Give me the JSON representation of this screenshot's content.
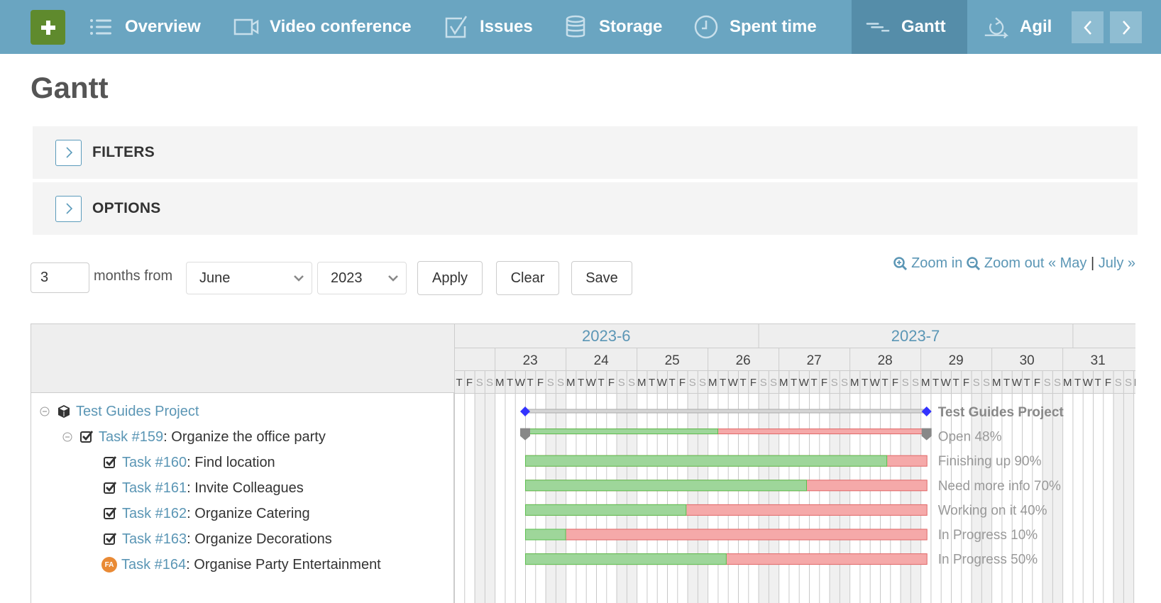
{
  "nav": {
    "add_label": "+",
    "items": [
      {
        "label": "Overview",
        "icon": "list-icon"
      },
      {
        "label": "Video conference",
        "icon": "video-camera-icon"
      },
      {
        "label": "Issues",
        "icon": "checkbox-icon"
      },
      {
        "label": "Storage",
        "icon": "database-icon"
      },
      {
        "label": "Spent time",
        "icon": "clock-icon"
      },
      {
        "label": "Gantt",
        "icon": "gantt-icon",
        "active": true
      },
      {
        "label": "Agil",
        "icon": "cycle-icon"
      }
    ],
    "colors": {
      "bar": "#6aa5c1",
      "active": "#558da9",
      "add": "#5f8a2d"
    }
  },
  "page": {
    "title": "Gantt"
  },
  "sections": {
    "filters": "FILTERS",
    "options": "OPTIONS"
  },
  "controls": {
    "months_value": "3",
    "months_from_label": "months from",
    "month_selected": "June",
    "year_selected": "2023",
    "apply": "Apply",
    "clear": "Clear",
    "save": "Save"
  },
  "zoom": {
    "zoom_in": "Zoom in",
    "zoom_out": "Zoom out",
    "prev": "« May",
    "separator": "|",
    "next": "July »"
  },
  "gantt": {
    "months": [
      "2023-6",
      "2023-7",
      ""
    ],
    "weeks": [
      "23",
      "24",
      "25",
      "26",
      "27",
      "28",
      "29",
      "30",
      "31"
    ],
    "day_letters": [
      "M",
      "T",
      "W",
      "T",
      "F",
      "S",
      "S"
    ],
    "rows": [
      {
        "type": "project",
        "link": "Test Guides Project",
        "text": "",
        "label": "Test Guides Project",
        "level": 0
      },
      {
        "type": "parent",
        "link": "Task #159",
        "text": ": Organize the office party",
        "label": "Open 48%",
        "progress": 48,
        "level": 1
      },
      {
        "type": "task",
        "link": "Task #160",
        "text": ": Find location",
        "label": "Finishing up 90%",
        "progress": 90,
        "level": 2
      },
      {
        "type": "task",
        "link": "Task #161",
        "text": ": Invite Colleagues",
        "label": "Need more info 70%",
        "progress": 70,
        "level": 2
      },
      {
        "type": "task",
        "link": "Task #162",
        "text": ": Organize Catering",
        "label": "Working on it 40%",
        "progress": 40,
        "level": 2
      },
      {
        "type": "task",
        "link": "Task #163",
        "text": ": Organize Decorations",
        "label": "In Progress 10%",
        "progress": 10,
        "level": 2
      },
      {
        "type": "task-avatar",
        "avatar": "FA",
        "link": "Task #164",
        "text": ": Organise Party Entertainment",
        "label": "In Progress 50%",
        "progress": 50,
        "level": 2
      }
    ],
    "colors": {
      "done": "#9ed69a",
      "done_border": "#5bbf4f",
      "todo": "#f5a9a9",
      "todo_border": "#e06666",
      "milestone": "#3333ff",
      "link": "#5b96b5"
    }
  }
}
